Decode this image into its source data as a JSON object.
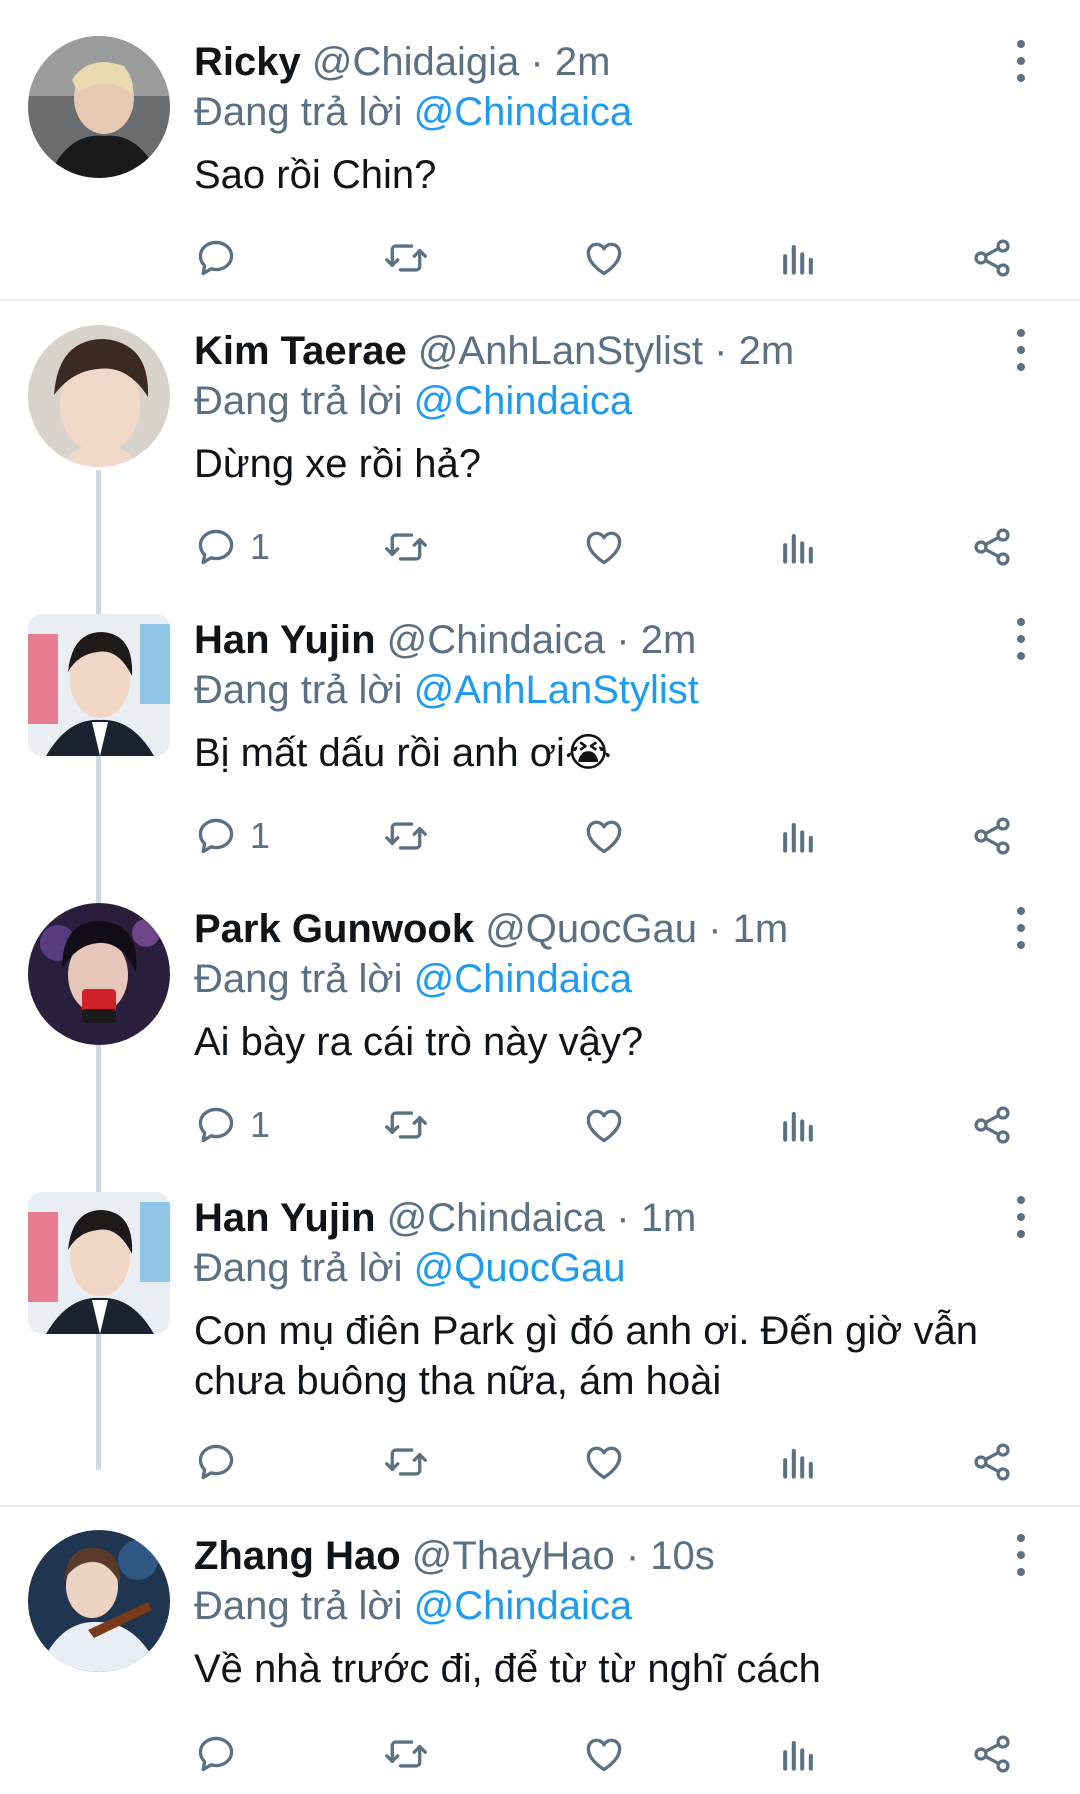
{
  "colors": {
    "accent": "#1d9bf0",
    "muted": "#5b7083",
    "text": "#0f1419",
    "divider": "#e6ecf0",
    "thread_line": "#cfd9de"
  },
  "replying_prefix": "Đang trả lời",
  "icons": [
    "more-vertical-icon",
    "reply-icon",
    "retweet-icon",
    "like-icon",
    "views-icon",
    "share-icon"
  ],
  "tweets": [
    {
      "name": "Ricky",
      "handle": "@Chidaigia",
      "time": "· 2m",
      "replying_to": "@Chindaica",
      "text": "Sao rồi Chin?",
      "reply_count": ""
    },
    {
      "name": "Kim Taerae",
      "handle": "@AnhLanStylist",
      "time": "· 2m",
      "replying_to": "@Chindaica",
      "text": "Dừng xe rồi hả?",
      "reply_count": "1"
    },
    {
      "name": "Han Yujin",
      "handle": "@Chindaica",
      "time": "· 2m",
      "replying_to": "@AnhLanStylist",
      "text": "Bị mất dấu rồi anh ơi😭",
      "reply_count": "1"
    },
    {
      "name": "Park Gunwook",
      "handle": "@QuocGau",
      "time": "· 1m",
      "replying_to": "@Chindaica",
      "text": "Ai bày ra cái trò này vậy?",
      "reply_count": "1"
    },
    {
      "name": "Han Yujin",
      "handle": "@Chindaica",
      "time": "· 1m",
      "replying_to": "@QuocGau",
      "text": "Con mụ điên Park gì đó anh ơi. Đến giờ vẫn chưa buông tha nữa, ám hoài",
      "reply_count": ""
    },
    {
      "name": "Zhang Hao",
      "handle": "@ThayHao",
      "time": "· 10s",
      "replying_to": "@Chindaica",
      "text": "Về nhà trước đi, để từ từ nghĩ cách",
      "reply_count": ""
    }
  ]
}
